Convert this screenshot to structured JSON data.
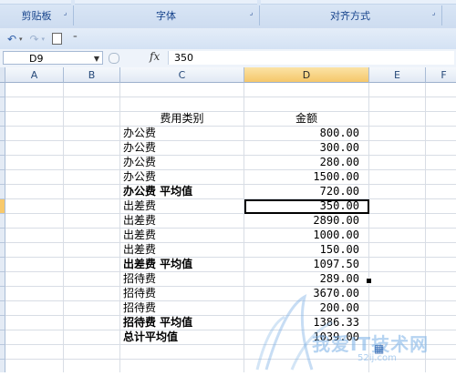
{
  "ribbon": {
    "groups": [
      {
        "label": "剪贴板"
      },
      {
        "label": "字体"
      },
      {
        "label": "对齐方式"
      }
    ]
  },
  "qat": {
    "undo_icon": "undo-icon",
    "redo_icon": "redo-icon",
    "new_icon": "new-document-icon",
    "customize_icon": "customize-qat-icon"
  },
  "formula_bar": {
    "name_box": "D9",
    "fx_label": "fx",
    "value": "350"
  },
  "columns": [
    "A",
    "B",
    "C",
    "D",
    "E",
    "F"
  ],
  "active_column": "D",
  "active_row": 9,
  "table": {
    "header": {
      "category": "费用类别",
      "amount": "金额"
    },
    "rows": [
      {
        "category": "办公费",
        "amount": "800.00",
        "bold": false
      },
      {
        "category": "办公费",
        "amount": "300.00",
        "bold": false
      },
      {
        "category": "办公费",
        "amount": "280.00",
        "bold": false
      },
      {
        "category": "办公费",
        "amount": "1500.00",
        "bold": false
      },
      {
        "category": "办公费 平均值",
        "amount": "720.00",
        "bold": true
      },
      {
        "category": "出差费",
        "amount": "350.00",
        "bold": false,
        "selected": true
      },
      {
        "category": "出差费",
        "amount": "2890.00",
        "bold": false
      },
      {
        "category": "出差费",
        "amount": "1000.00",
        "bold": false
      },
      {
        "category": "出差费",
        "amount": "150.00",
        "bold": false
      },
      {
        "category": "出差费 平均值",
        "amount": "1097.50",
        "bold": true
      },
      {
        "category": "招待费",
        "amount": "289.00",
        "bold": false
      },
      {
        "category": "招待费",
        "amount": "3670.00",
        "bold": false
      },
      {
        "category": "招待费",
        "amount": "200.00",
        "bold": false
      },
      {
        "category": "招待费 平均值",
        "amount": "1386.33",
        "bold": true
      },
      {
        "category": "总计平均值",
        "amount": "1039.00",
        "bold": true
      }
    ]
  },
  "watermark": {
    "text": "我爱IT技术网",
    "url": "52ij.com"
  }
}
